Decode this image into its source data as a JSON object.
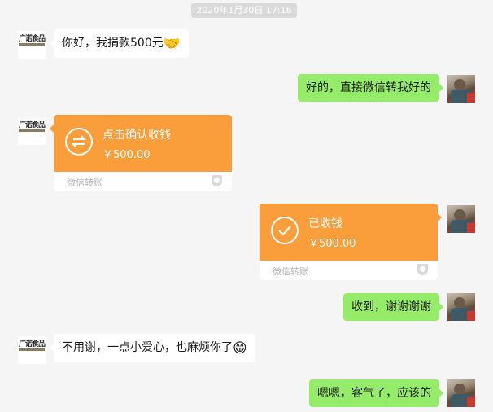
{
  "chat": {
    "timestamp": "2020年1月30日 17:16",
    "contact_name": "广诺食品",
    "messages": [
      {
        "from": "them",
        "type": "text",
        "text": "你好，我捐款500元",
        "emoji": "🤝"
      },
      {
        "from": "me",
        "type": "text",
        "text": "好的，直接微信转我好的"
      },
      {
        "from": "them",
        "type": "transfer",
        "title": "点击确认收钱",
        "amount": "￥500.00",
        "footer": "微信转账",
        "icon": "transfer-arrows-icon"
      },
      {
        "from": "me",
        "type": "transfer",
        "title": "已收钱",
        "amount": "￥500.00",
        "footer": "微信转账",
        "icon": "checkmark-icon"
      },
      {
        "from": "me",
        "type": "text",
        "text": "收到，谢谢谢谢"
      },
      {
        "from": "them",
        "type": "text",
        "text": "不用谢，一点小爱心，也麻烦你了",
        "emoji": "😁"
      },
      {
        "from": "me",
        "type": "text",
        "text": "嗯嗯，客气了，应该的"
      }
    ]
  },
  "colors": {
    "background": "#f5f5f5",
    "incoming_bubble": "#ffffff",
    "outgoing_bubble": "#95ec69",
    "transfer_orange": "#fa9d3b",
    "timestamp_chip": "#dadada"
  }
}
